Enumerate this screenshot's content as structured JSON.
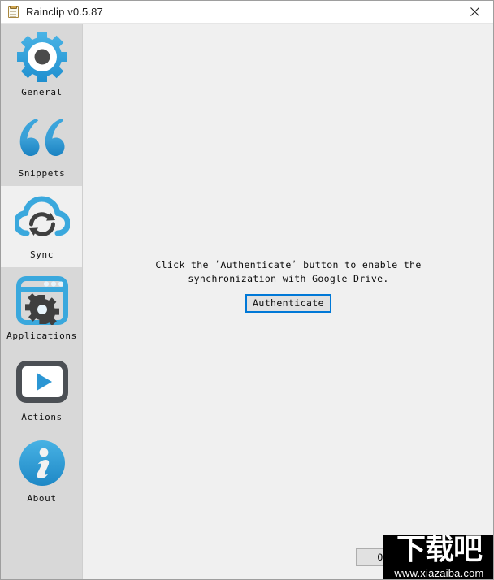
{
  "window": {
    "title": "Rainclip v0.5.87",
    "icon": "clipboard-icon",
    "close_label": "✕"
  },
  "sidebar": {
    "items": [
      {
        "label": "General",
        "icon": "gear-icon",
        "selected": false
      },
      {
        "label": "Snippets",
        "icon": "quotes-icon",
        "selected": false
      },
      {
        "label": "Sync",
        "icon": "cloud-sync-icon",
        "selected": true
      },
      {
        "label": "Applications",
        "icon": "window-gear-icon",
        "selected": false
      },
      {
        "label": "Actions",
        "icon": "play-screen-icon",
        "selected": false
      },
      {
        "label": "About",
        "icon": "info-icon",
        "selected": false
      }
    ]
  },
  "main": {
    "message": "Click the ʹAuthenticateʹ button to enable the synchronization with Google Drive.",
    "authenticate_label": "Authenticate"
  },
  "footer": {
    "ok_label": "O"
  },
  "watermark": {
    "cjk": "下载吧",
    "url": "www.xiazaiba.com"
  },
  "colors": {
    "accent_blue": "#0078d7",
    "icon_blue": "#3aa8dd",
    "sidebar_bg": "#d8d8d8",
    "content_bg": "#f0f0f0",
    "titlebar_bg": "#ffffff"
  }
}
